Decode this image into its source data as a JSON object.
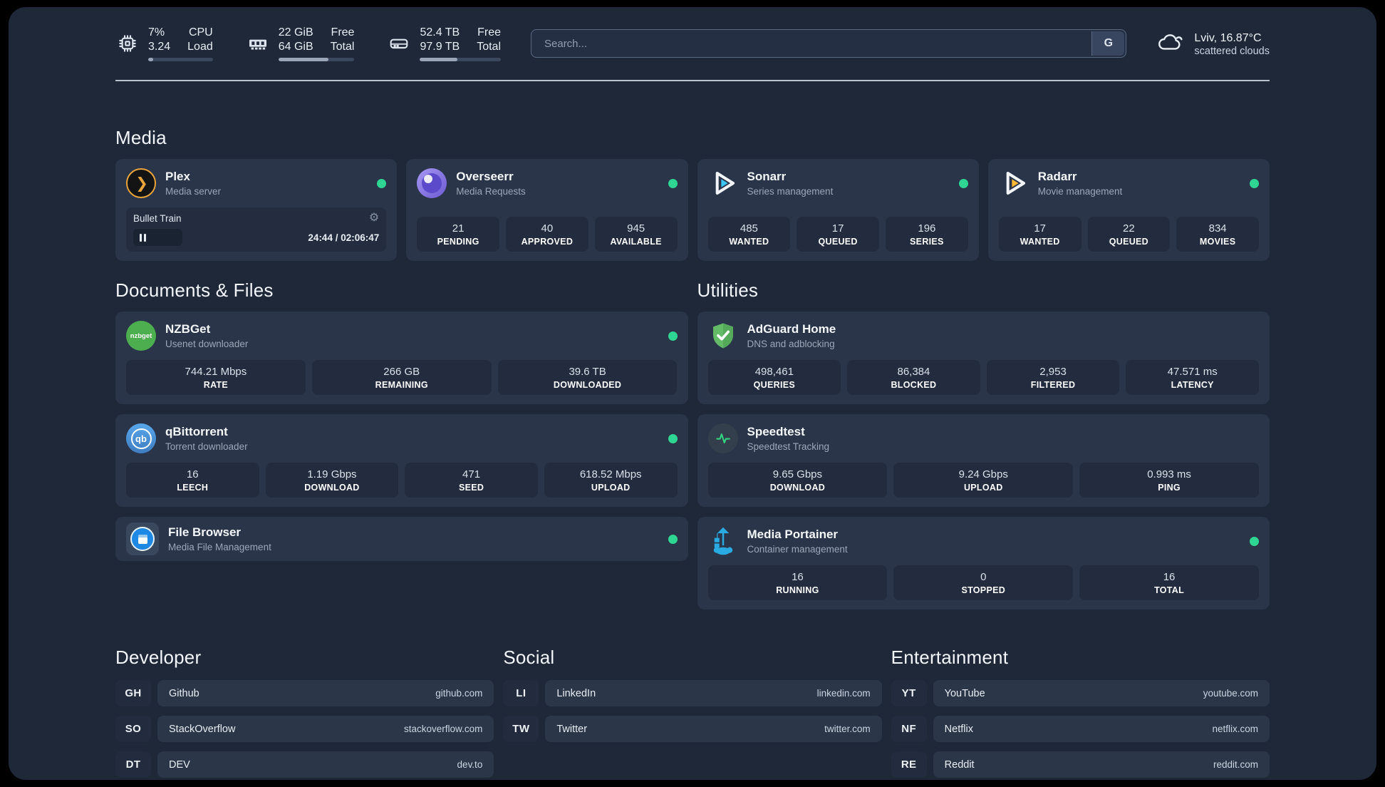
{
  "header": {
    "resources": [
      {
        "icon": "cpu",
        "line1": "7%",
        "line2": "3.24",
        "label1": "CPU",
        "label2": "Load",
        "progress": 8
      },
      {
        "icon": "memory",
        "line1": "22 GiB",
        "line2": "64 GiB",
        "label1": "Free",
        "label2": "Total",
        "progress": 66
      },
      {
        "icon": "disk",
        "line1": "52.4 TB",
        "line2": "97.9 TB",
        "label1": "Free",
        "label2": "Total",
        "progress": 46
      }
    ],
    "search": {
      "placeholder": "Search...",
      "button_label": "G"
    },
    "weather": {
      "location": "Lviv, 16.87°C",
      "condition": "scattered clouds"
    }
  },
  "sections": {
    "media": {
      "title": "Media"
    },
    "documents": {
      "title": "Documents & Files"
    },
    "utilities": {
      "title": "Utilities"
    },
    "developer": {
      "title": "Developer"
    },
    "social": {
      "title": "Social"
    },
    "entertainment": {
      "title": "Entertainment"
    }
  },
  "services": {
    "plex": {
      "name": "Plex",
      "description": "Media server",
      "online": true,
      "player": {
        "title": "Bullet Train",
        "time": "24:44 / 02:06:47",
        "progress": 20
      }
    },
    "overseerr": {
      "name": "Overseerr",
      "description": "Media Requests",
      "online": true,
      "stats": [
        {
          "value": "21",
          "label": "PENDING"
        },
        {
          "value": "40",
          "label": "APPROVED"
        },
        {
          "value": "945",
          "label": "AVAILABLE"
        }
      ]
    },
    "sonarr": {
      "name": "Sonarr",
      "description": "Series management",
      "online": true,
      "stats": [
        {
          "value": "485",
          "label": "WANTED"
        },
        {
          "value": "17",
          "label": "QUEUED"
        },
        {
          "value": "196",
          "label": "SERIES"
        }
      ]
    },
    "radarr": {
      "name": "Radarr",
      "description": "Movie management",
      "online": true,
      "stats": [
        {
          "value": "17",
          "label": "WANTED"
        },
        {
          "value": "22",
          "label": "QUEUED"
        },
        {
          "value": "834",
          "label": "MOVIES"
        }
      ]
    },
    "nzbget": {
      "name": "NZBGet",
      "description": "Usenet downloader",
      "online": true,
      "icon_text": "nzbget",
      "stats": [
        {
          "value": "744.21 Mbps",
          "label": "RATE"
        },
        {
          "value": "266 GB",
          "label": "REMAINING"
        },
        {
          "value": "39.6 TB",
          "label": "DOWNLOADED"
        }
      ]
    },
    "qbittorrent": {
      "name": "qBittorrent",
      "description": "Torrent downloader",
      "online": true,
      "icon_text": "qb",
      "stats": [
        {
          "value": "16",
          "label": "LEECH"
        },
        {
          "value": "1.19 Gbps",
          "label": "DOWNLOAD"
        },
        {
          "value": "471",
          "label": "SEED"
        },
        {
          "value": "618.52 Mbps",
          "label": "UPLOAD"
        }
      ]
    },
    "filebrowser": {
      "name": "File Browser",
      "description": "Media File Management",
      "online": true
    },
    "adguard": {
      "name": "AdGuard Home",
      "description": "DNS and adblocking",
      "online": false,
      "stats": [
        {
          "value": "498,461",
          "label": "QUERIES"
        },
        {
          "value": "86,384",
          "label": "BLOCKED"
        },
        {
          "value": "2,953",
          "label": "FILTERED"
        },
        {
          "value": "47.571 ms",
          "label": "LATENCY"
        }
      ]
    },
    "speedtest": {
      "name": "Speedtest",
      "description": "Speedtest Tracking",
      "online": false,
      "stats": [
        {
          "value": "9.65 Gbps",
          "label": "DOWNLOAD"
        },
        {
          "value": "9.24 Gbps",
          "label": "UPLOAD"
        },
        {
          "value": "0.993 ms",
          "label": "PING"
        }
      ]
    },
    "portainer": {
      "name": "Media Portainer",
      "description": "Container management",
      "online": true,
      "stats": [
        {
          "value": "16",
          "label": "RUNNING"
        },
        {
          "value": "0",
          "label": "STOPPED"
        },
        {
          "value": "16",
          "label": "TOTAL"
        }
      ]
    }
  },
  "bookmarks": {
    "developer": [
      {
        "abbr": "GH",
        "name": "Github",
        "url": "github.com"
      },
      {
        "abbr": "SO",
        "name": "StackOverflow",
        "url": "stackoverflow.com"
      },
      {
        "abbr": "DT",
        "name": "DEV",
        "url": "dev.to"
      }
    ],
    "social": [
      {
        "abbr": "LI",
        "name": "LinkedIn",
        "url": "linkedin.com"
      },
      {
        "abbr": "TW",
        "name": "Twitter",
        "url": "twitter.com"
      }
    ],
    "entertainment": [
      {
        "abbr": "YT",
        "name": "YouTube",
        "url": "youtube.com"
      },
      {
        "abbr": "NF",
        "name": "Netflix",
        "url": "netflix.com"
      },
      {
        "abbr": "RE",
        "name": "Reddit",
        "url": "reddit.com"
      }
    ]
  },
  "colors": {
    "background": "#1E2839",
    "card": "#2A3549",
    "pill": "#222C3E",
    "status_online": "#2FD693",
    "plex_accent": "#E9A43B",
    "sonarr_accent": "#3EC6F4",
    "radarr_accent": "#FFB835",
    "portainer_accent": "#29ABE2"
  }
}
